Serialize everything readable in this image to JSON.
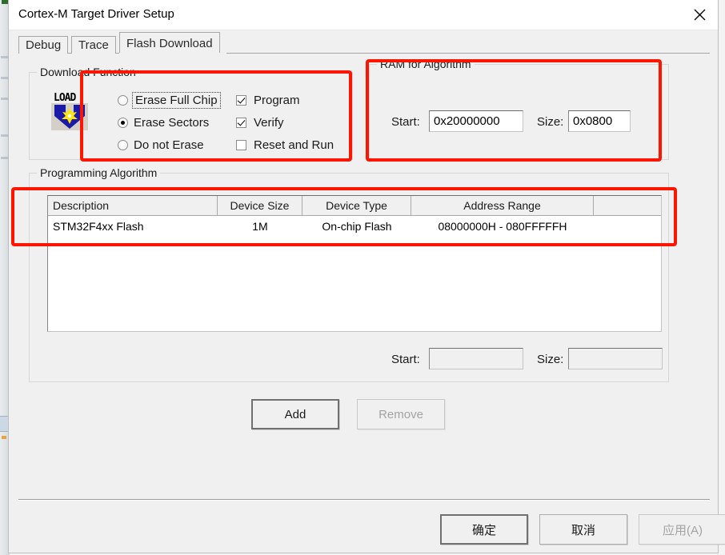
{
  "window": {
    "title": "Cortex-M Target Driver Setup",
    "close_icon": "close-icon"
  },
  "tabs": [
    {
      "label": "Debug",
      "active": false
    },
    {
      "label": "Trace",
      "active": false
    },
    {
      "label": "Flash Download",
      "active": true
    }
  ],
  "download_function": {
    "title": "Download Function",
    "icon_text": "LOAD",
    "radios": [
      {
        "label": "Erase Full Chip",
        "checked": false,
        "focused": true
      },
      {
        "label": "Erase Sectors",
        "checked": true,
        "focused": false
      },
      {
        "label": "Do not Erase",
        "checked": false,
        "focused": false
      }
    ],
    "checkboxes": [
      {
        "label": "Program",
        "checked": true
      },
      {
        "label": "Verify",
        "checked": true
      },
      {
        "label": "Reset and Run",
        "checked": false
      }
    ]
  },
  "ram_for_algorithm": {
    "title": "RAM for Algorithm",
    "start_label": "Start:",
    "start_value": "0x20000000",
    "size_label": "Size:",
    "size_value": "0x0800"
  },
  "programming_algorithm": {
    "title": "Programming Algorithm",
    "columns": [
      "Description",
      "Device Size",
      "Device Type",
      "Address Range",
      ""
    ],
    "rows": [
      {
        "description": "STM32F4xx Flash",
        "device_size": "1M",
        "device_type": "On-chip Flash",
        "address_range": "08000000H - 080FFFFFH"
      }
    ],
    "start_label": "Start:",
    "start_value": "",
    "size_label": "Size:",
    "size_value": "",
    "add_label": "Add",
    "remove_label": "Remove"
  },
  "footer": {
    "ok_label": "确定",
    "cancel_label": "取消",
    "apply_label": "应用(A)"
  },
  "colors": {
    "annotation": "#fe1500",
    "dialog_bg": "#f0f0f0",
    "field_bg": "#ffffff"
  }
}
